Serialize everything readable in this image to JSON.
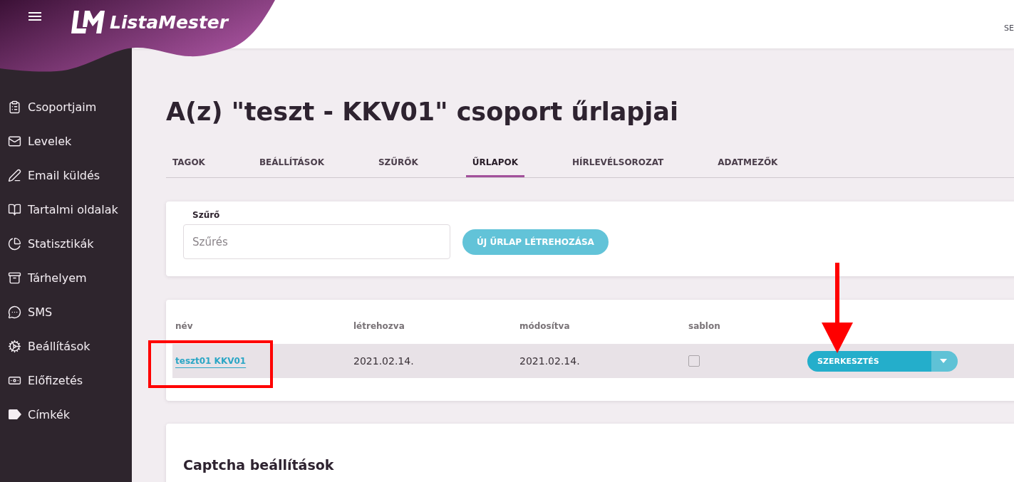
{
  "header": {
    "logo_text": "ListaMester",
    "user_menu_text": "SE"
  },
  "sidebar": {
    "items": [
      {
        "label": "Csoportjaim"
      },
      {
        "label": "Levelek"
      },
      {
        "label": "Email küldés"
      },
      {
        "label": "Tartalmi oldalak"
      },
      {
        "label": "Statisztikák"
      },
      {
        "label": "Tárhelyem"
      },
      {
        "label": "SMS"
      },
      {
        "label": "Beállítások"
      },
      {
        "label": "Előfizetés"
      },
      {
        "label": "Címkék"
      }
    ]
  },
  "page_title": "A(z) \"teszt - KKV01\" csoport űrlapjai",
  "tabs": [
    {
      "label": "TAGOK",
      "selected": false
    },
    {
      "label": "BEÁLLÍTÁSOK",
      "selected": false
    },
    {
      "label": "SZŰRŐK",
      "selected": false
    },
    {
      "label": "ŰRLAPOK",
      "selected": true
    },
    {
      "label": "HÍRLEVÉLSOROZAT",
      "selected": false
    },
    {
      "label": "ADATMEZŐK",
      "selected": false
    }
  ],
  "filter_panel": {
    "label": "Szűrő",
    "placeholder": "Szűrés",
    "create_button": "ÚJ ŰRLAP LÉTREHOZÁSA"
  },
  "forms_table": {
    "columns": [
      "név",
      "létrehozva",
      "módosítva",
      "sablon"
    ],
    "rows": [
      {
        "name": "teszt01 KKV01",
        "created": "2021.02.14.",
        "modified": "2021.02.14.",
        "template": false,
        "action": "SZERKESZTÉS"
      }
    ]
  },
  "captcha_panel": {
    "title": "Captcha beállítások"
  }
}
